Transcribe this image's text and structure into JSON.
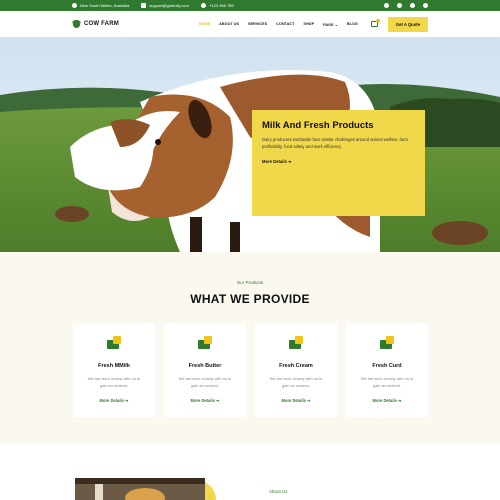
{
  "topbar": {
    "address": "New South Wales, Australia",
    "email": "support@gotenify.com",
    "phone": "+123 456 789",
    "social": [
      "facebook-icon",
      "twitter-icon",
      "youtube-icon",
      "instagram-icon"
    ]
  },
  "header": {
    "logo": "COW FARM",
    "nav": [
      "HOME",
      "ABOUT US",
      "SERVICES",
      "CONTACT",
      "SHOP",
      "PAGE",
      "BLOG"
    ],
    "active_index": 0,
    "quote_button": "Get A Quote"
  },
  "hero": {
    "title": "Milk And Fresh Products",
    "text": "Dairy producers worldwide face similar challenges around animal welfare, farm profitability, food safety and work efficiency.",
    "more": "More Details"
  },
  "products": {
    "subtitle": "Our Products",
    "title": "WHAT WE PROVIDE",
    "items": [
      {
        "name": "Fresh MMilk",
        "desc": "We are work closely with on to gain an underst.",
        "more": "More Details"
      },
      {
        "name": "Fresh Butter",
        "desc": "We are work closely with on to gain an underst.",
        "more": "More Details"
      },
      {
        "name": "Fresh Cream",
        "desc": "We are work closely with on to gain an underst.",
        "more": "More Details"
      },
      {
        "name": "Fresh Curd",
        "desc": "We are work closely with on to gain an underst.",
        "more": "More Details"
      }
    ]
  },
  "about": {
    "label": "About Us"
  },
  "colors": {
    "brand_green": "#2f7a2f",
    "accent_yellow": "#f0d84a"
  }
}
